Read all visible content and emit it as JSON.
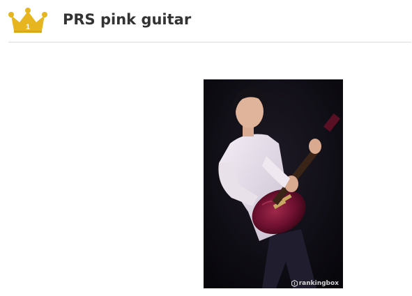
{
  "item": {
    "rank": "1",
    "title": "PRS pink guitar",
    "rank_icon": "crown-icon",
    "crown_color": "#e6b520"
  },
  "photo": {
    "watermark": "rankingbox"
  }
}
